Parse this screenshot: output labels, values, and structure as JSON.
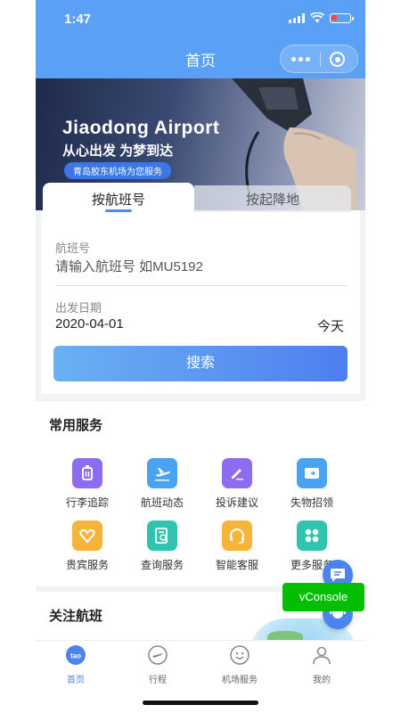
{
  "status_bar": {
    "time": "1:47"
  },
  "nav": {
    "title": "首页"
  },
  "banner": {
    "title": "Jiaodong Airport",
    "slogan": "从心出发  为梦到达",
    "pill": "青岛胶东机场为您服务"
  },
  "search_tabs": {
    "active": "按航班号",
    "inactive": "按起降地"
  },
  "flight_field": {
    "label": "航班号",
    "placeholder": "请输入航班号 如MU5192"
  },
  "date_field": {
    "label": "出发日期",
    "value": "2020-04-01",
    "today": "今天"
  },
  "search_button": "搜索",
  "services": {
    "title": "常用服务",
    "items": [
      {
        "label": "行李追踪",
        "icon": "luggage-icon",
        "color": "#8e6cf0"
      },
      {
        "label": "航班动态",
        "icon": "airplane-icon",
        "color": "#4aa3f2"
      },
      {
        "label": "投诉建议",
        "icon": "edit-icon",
        "color": "#8e6cf0"
      },
      {
        "label": "失物招领",
        "icon": "wallet-icon",
        "color": "#4aa3f2"
      },
      {
        "label": "贵宾服务",
        "icon": "heart-icon",
        "color": "#f6b43a"
      },
      {
        "label": "查询服务",
        "icon": "document-search-icon",
        "color": "#2fc3b0"
      },
      {
        "label": "智能客服",
        "icon": "headset-icon",
        "color": "#f6b43a"
      },
      {
        "label": "更多服务",
        "icon": "grid-icon",
        "color": "#2fc3b0"
      }
    ]
  },
  "follow_section": {
    "title": "关注航班"
  },
  "vconsole": "vConsole",
  "tabbar": [
    {
      "label": "首页",
      "icon": "home-logo-icon",
      "active": true
    },
    {
      "label": "行程",
      "icon": "trip-icon",
      "active": false
    },
    {
      "label": "机场服务",
      "icon": "smile-service-icon",
      "active": false
    },
    {
      "label": "我的",
      "icon": "user-icon",
      "active": false
    }
  ]
}
